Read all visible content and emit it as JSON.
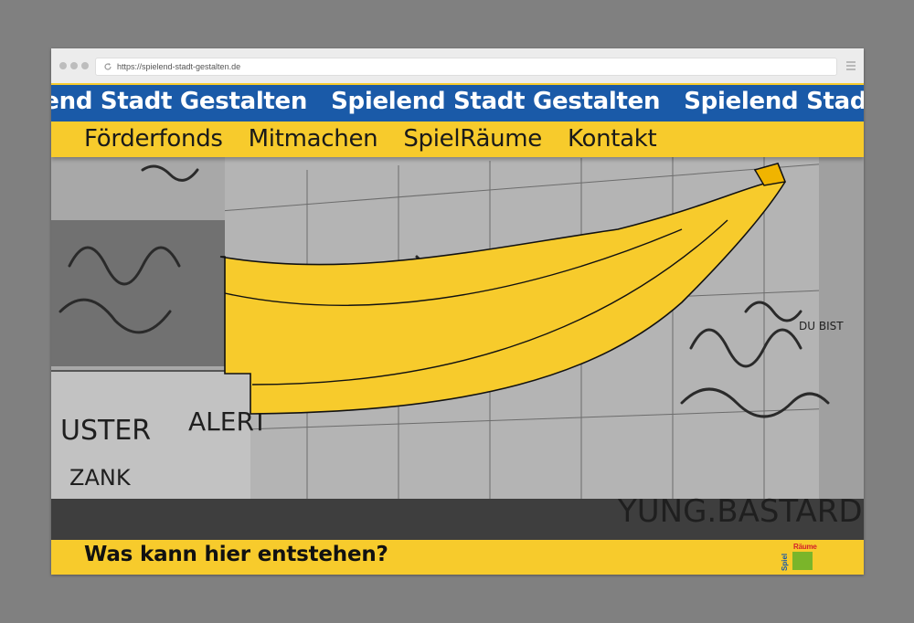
{
  "browser": {
    "url": "https://spielend-stadt-gestalten.de"
  },
  "site": {
    "ticker_text": "Spielend Stadt Gestalten",
    "ticker_repeats": [
      "Spielend Stadt Gestalten",
      "Spielend Stadt Gestalten",
      "Spielend Stadt Gestalten"
    ],
    "nav": [
      {
        "label": "Förderfonds"
      },
      {
        "label": "Mitmachen"
      },
      {
        "label": "SpielRäume"
      },
      {
        "label": "Kontakt"
      }
    ],
    "headline": "Was kann hier entstehen?",
    "logo": {
      "top_text": "Räume",
      "side_text": "Spiel"
    }
  },
  "hero": {
    "image": "black-and-white photo of graffiti-covered walls with a large yellow banana illustration",
    "graffiti_texts": [
      "ALERT",
      "YUNG.BASTARD",
      "USTER",
      "ZANK",
      "DU BIST"
    ]
  },
  "colors": {
    "accent_yellow": "#f7cb2c",
    "brand_blue": "#1a5aa8",
    "logo_red": "#d4202a",
    "logo_green": "#7ab52a",
    "background_gray": "#808080"
  },
  "icons": [
    "reload-icon",
    "hamburger-menu-icon",
    "window-dots"
  ]
}
